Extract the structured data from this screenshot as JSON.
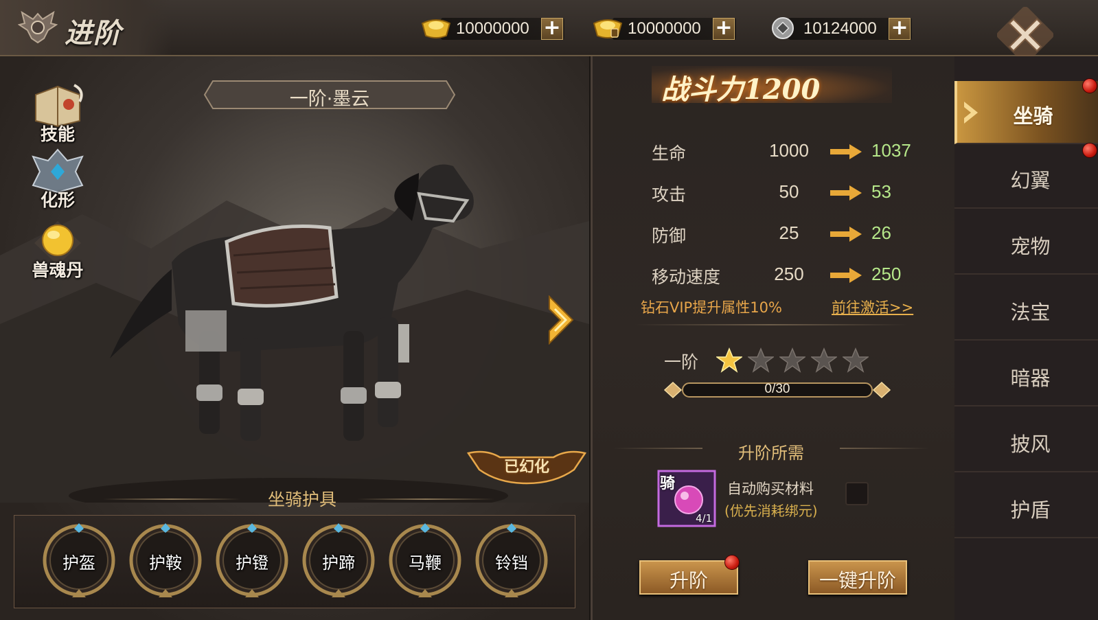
{
  "header": {
    "title": "进阶"
  },
  "currencies": [
    {
      "icon": "gold-ingot-icon",
      "value": "10000000"
    },
    {
      "icon": "bound-gold-ingot-icon",
      "value": "10000000"
    },
    {
      "icon": "silver-coin-icon",
      "value": "10124000"
    }
  ],
  "left": {
    "mount_name": "一阶·墨云",
    "side_buttons": [
      "技能",
      "化形",
      "兽魂丹"
    ],
    "badge": "已幻化",
    "armor_title": "坐骑护具",
    "armor_items": [
      "护盔",
      "护鞍",
      "护镫",
      "护蹄",
      "马鞭",
      "铃铛"
    ]
  },
  "stats": {
    "power": "战斗力1200",
    "rows": [
      {
        "name": "生命",
        "current": "1000",
        "next": "1037"
      },
      {
        "name": "攻击",
        "current": "50",
        "next": "53"
      },
      {
        "name": "防御",
        "current": "25",
        "next": "26"
      },
      {
        "name": "移动速度",
        "current": "250",
        "next": "250"
      }
    ],
    "vip_text": "钻石VIP提升属性10%",
    "vip_link": "前往激活>>",
    "tier": "一阶",
    "stars_filled": 1,
    "stars_total": 5,
    "progress_text": "0/30",
    "progress_fraction": 0,
    "requirements_title": "升阶所需",
    "item_label": "骑",
    "item_count": "4/1",
    "auto_buy": "自动购买材料",
    "auto_buy_note": "(优先消耗绑元)",
    "btn_upgrade": "升阶",
    "btn_one_key": "一键升阶"
  },
  "tabs": [
    "坐骑",
    "幻翼",
    "宠物",
    "法宝",
    "暗器",
    "披风",
    "护盾"
  ],
  "colors": {
    "accent": "#e2be7a",
    "next_value": "#b6e88a",
    "vip": "#e8a64a"
  }
}
